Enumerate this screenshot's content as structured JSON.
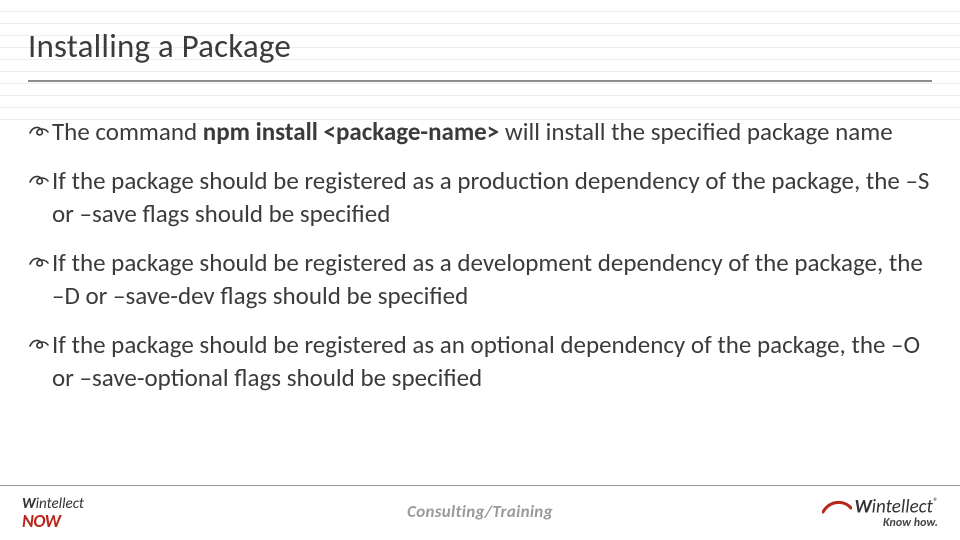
{
  "title": "Installing a Package",
  "bullets": [
    {
      "pre": "The command ",
      "bold": "npm install <package-name>",
      "post": " will install the specified package name"
    },
    {
      "pre": "If the package should be registered as a production dependency of the package, the –S or –save flags should be specified",
      "bold": "",
      "post": ""
    },
    {
      "pre": "If the package should be registered as a development dependency of the package, the –D or –save-dev flags should be specified",
      "bold": "",
      "post": ""
    },
    {
      "pre": "If the package should be registered as an optional dependency of the package, the –O or –save-optional flags should be specified",
      "bold": "",
      "post": ""
    }
  ],
  "footer": {
    "tag": "Consulting/Training"
  },
  "logoLeft": {
    "line1a": "W",
    "line1b": "intellect",
    "line2": "NOW"
  },
  "logoRight": {
    "brand1": "W",
    "brand2": "intellect",
    "reg": "®",
    "tag": "Know how."
  }
}
